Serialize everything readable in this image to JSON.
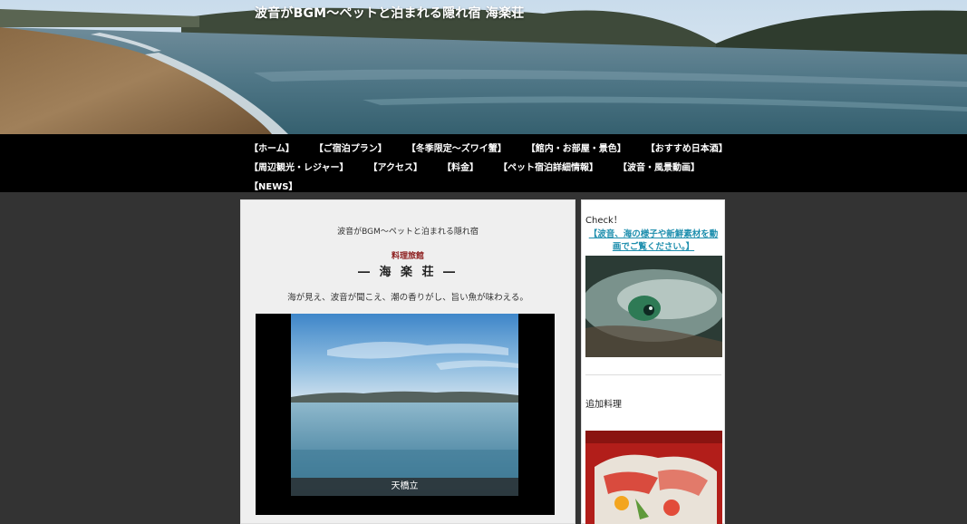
{
  "site": {
    "title": "波音がBGM〜ペットと泊まれる隠れ宿 海楽荘"
  },
  "nav": {
    "rows": [
      [
        "【ホーム】",
        "【ご宿泊プラン】",
        "【冬季限定〜ズワイ蟹】",
        "【館内・お部屋・景色】",
        "【おすすめ日本酒】"
      ],
      [
        "【周辺観光・レジャー】",
        "【アクセス】",
        "【料金】",
        "【ペット宿泊詳細情報】",
        "【波音・風景動画】"
      ],
      [
        "【NEWS】"
      ]
    ]
  },
  "main": {
    "subtitle": "波音がBGM〜ペットと泊まれる隠れ宿",
    "category": "料理旅館",
    "inn_name": "― 海 楽 荘 ―",
    "tagline": "海が見え、波音が聞こえ、潮の香りがし、旨い魚が味わえる。",
    "slide_caption": "天橋立"
  },
  "sidebar": {
    "check_title": "Check！",
    "video_link": "【波音、海の様子や新鮮素材を動画でご覧ください。】",
    "extra_title": "追加料理"
  },
  "colors": {
    "background": "#333333",
    "nav_bg": "#000000",
    "link": "#1f8fae",
    "category_red": "#8b1a1a"
  }
}
